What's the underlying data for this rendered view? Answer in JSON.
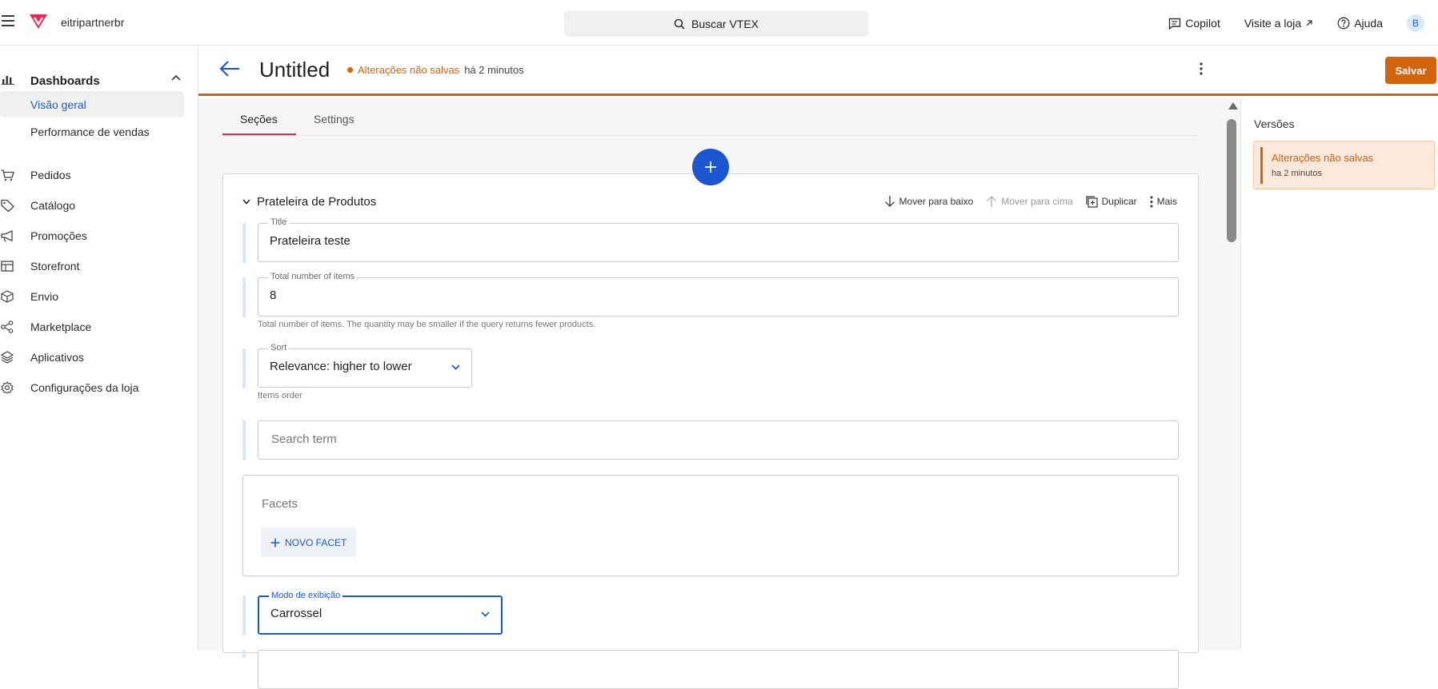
{
  "topbar": {
    "account": "eitripartnerbr",
    "search_label": "Buscar VTEX",
    "copilot": "Copilot",
    "visit_store": "Visite a loja",
    "help": "Ajuda",
    "avatar_initial": "B",
    "brand_color": "#e5284f"
  },
  "sidebar": {
    "group_title": "Dashboards",
    "sub_items": [
      {
        "label": "Visão geral",
        "active": true
      },
      {
        "label": "Performance de vendas",
        "active": false
      }
    ],
    "items": [
      {
        "label": "Pedidos",
        "icon": "cart-icon"
      },
      {
        "label": "Catálogo",
        "icon": "tag-icon"
      },
      {
        "label": "Promoções",
        "icon": "megaphone-icon"
      },
      {
        "label": "Storefront",
        "icon": "layout-icon"
      },
      {
        "label": "Envio",
        "icon": "box-icon"
      },
      {
        "label": "Marketplace",
        "icon": "share-icon"
      },
      {
        "label": "Aplicativos",
        "icon": "layers-icon"
      },
      {
        "label": "Configurações da loja",
        "icon": "gear-icon"
      }
    ]
  },
  "editor": {
    "title": "Untitled",
    "status_warning": "Alterações não salvas",
    "status_time": "há 2 minutos",
    "save_label": "Salvar",
    "accent_color": "#d3640e",
    "tabs": [
      "Seções",
      "Settings"
    ],
    "section": {
      "name": "Prateleira de Produtos",
      "actions": {
        "move_down": "Mover para baixo",
        "move_up": "Mover para cima",
        "duplicate": "Duplicar",
        "more": "Mais"
      },
      "title_field": {
        "label": "Title",
        "value": "Prateleira teste"
      },
      "total_field": {
        "label": "Total number of items",
        "value": "8",
        "helper": "Total number of items. The quantity may be smaller if the query returns fewer products."
      },
      "sort_field": {
        "label": "Sort",
        "value": "Relevance: higher to lower",
        "helper": "Items order"
      },
      "search_field": {
        "placeholder": "Search term"
      },
      "facets": {
        "title": "Facets",
        "button": "NOVO FACET"
      },
      "display_mode": {
        "label": "Modo de exibição",
        "value": "Carrossel"
      }
    }
  },
  "versions": {
    "title": "Versões",
    "entry_title": "Alterações não salvas",
    "entry_time": "ha 2 minutos"
  }
}
